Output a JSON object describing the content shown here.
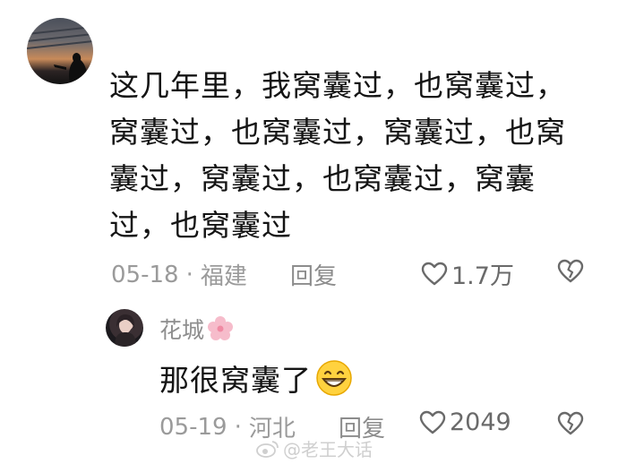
{
  "comment": {
    "text": "这几年里，我窝囊过，也窝囊过，窝囊过，也窝囊过，窝囊过，也窝囊过，窝囊过，也窝囊过，窝囊过，也窝囊过",
    "date": "05-18",
    "dot": "·",
    "location": "福建",
    "reply_label": "回复",
    "likes": "1.7万"
  },
  "reply": {
    "user": "花城",
    "text": "那很窝囊了",
    "date": "05-19",
    "dot": "·",
    "location": "河北",
    "reply_label": "回复",
    "likes": "2049"
  },
  "watermark": {
    "text": "@老王大话"
  },
  "icons": {
    "heart": "heart-icon",
    "broken_heart": "broken-heart-icon",
    "flower": "flower-icon",
    "grin": "grin-emoji-icon",
    "weibo": "weibo-icon"
  },
  "colors": {
    "meta": "#9a9a9a",
    "text": "#141414",
    "flower": "#f4b4c4"
  }
}
